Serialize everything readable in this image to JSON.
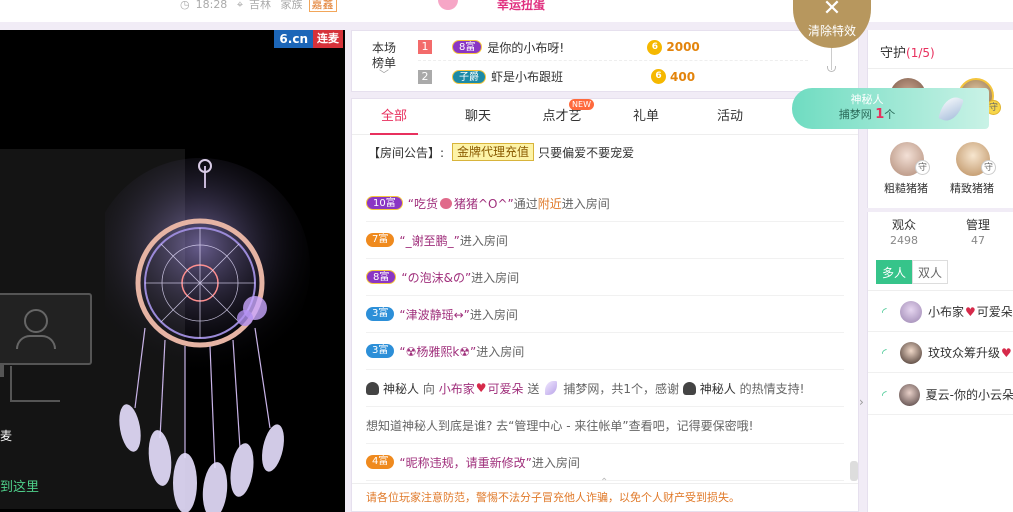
{
  "top": {
    "time": "18:28",
    "location": "吉林",
    "family": "家族",
    "family_tag": "嘉鑫",
    "lucky": "幸运扭蛋"
  },
  "clear_effects": {
    "label": "清除特效"
  },
  "video": {
    "badge_site": "6.cn",
    "badge_mic": "连麦",
    "left_text": "麦",
    "left_link": "到这里"
  },
  "rank": {
    "label_line1": "本场",
    "label_line2": "榜单",
    "rows": [
      {
        "num": "1",
        "level": "8富",
        "name": "是你的小布呀!",
        "value": "2000"
      },
      {
        "num": "2",
        "level": "子爵",
        "name": "虾是小布跟班",
        "value": "400"
      }
    ]
  },
  "tabs": [
    {
      "label": "全部"
    },
    {
      "label": "聊天"
    },
    {
      "label": "点才艺",
      "badge": "NEW"
    },
    {
      "label": "礼单"
    },
    {
      "label": "活动"
    }
  ],
  "notice": {
    "prefix": "【房间公告】:",
    "gold_label": "金牌代理充值",
    "text": "只要偏爱不要宠爱"
  },
  "messages": [
    {
      "level": "10富",
      "name_a": "“吃货",
      "name_b": "猪猪^O^”",
      "via": "通过",
      "via_hl": "附近",
      "suffix": "进入房间"
    },
    {
      "level": "7富",
      "name": "“_谢至鹏_”",
      "suffix": "进入房间"
    },
    {
      "level": "8富",
      "name": "“の泡沫&の”",
      "suffix": "进入房间"
    },
    {
      "level": "3富",
      "name": "“津波静瑶↔”",
      "suffix": "进入房间"
    },
    {
      "level": "3富",
      "name": "“☢杨雅熙k☢”",
      "suffix": "进入房间"
    },
    {
      "gift": {
        "from": "神秘人",
        "to_word": "向",
        "target": "小布家",
        "target2": "可爱朵",
        "send": "送",
        "item": "捕梦网，共1个，感谢",
        "thanks_name": "神秘人",
        "thanks_suffix": "的热情支持!"
      }
    },
    {
      "text": "想知道神秘人到底是谁? 去“管理中心 - 来往帐单”查看吧，记得要保密哦!"
    },
    {
      "level": "4富",
      "name": "“昵称违规，请重新修改”",
      "suffix": "进入房间"
    }
  ],
  "warning": "请各位玩家注意防范，警惕不法分子冒充他人诈骗，以免个人财产受到损失。",
  "guard": {
    "title": "守护",
    "count": "(1/5)",
    "badge": "守",
    "members": [
      {
        "name": "粗糙猪猪"
      },
      {
        "name": "精致猪猪"
      }
    ]
  },
  "mystery": {
    "title": "神秘人",
    "gift": "捕梦网",
    "count": "1",
    "unit": "个"
  },
  "audience": {
    "viewers_label": "观众",
    "viewers_count": "2498",
    "admin_label": "管理",
    "admin_count": "47",
    "mode_multi": "多人",
    "mode_dual": "双人",
    "list": [
      {
        "name": "小布家",
        "name2": "可爱朵"
      },
      {
        "name": "玟玟众筹升级"
      },
      {
        "name": "夏云-你的小云朵"
      }
    ]
  },
  "colors": {
    "accent": "#e8305e",
    "coin": "#f5b800",
    "green": "#36c48a",
    "gold_tan": "#b7975e"
  }
}
